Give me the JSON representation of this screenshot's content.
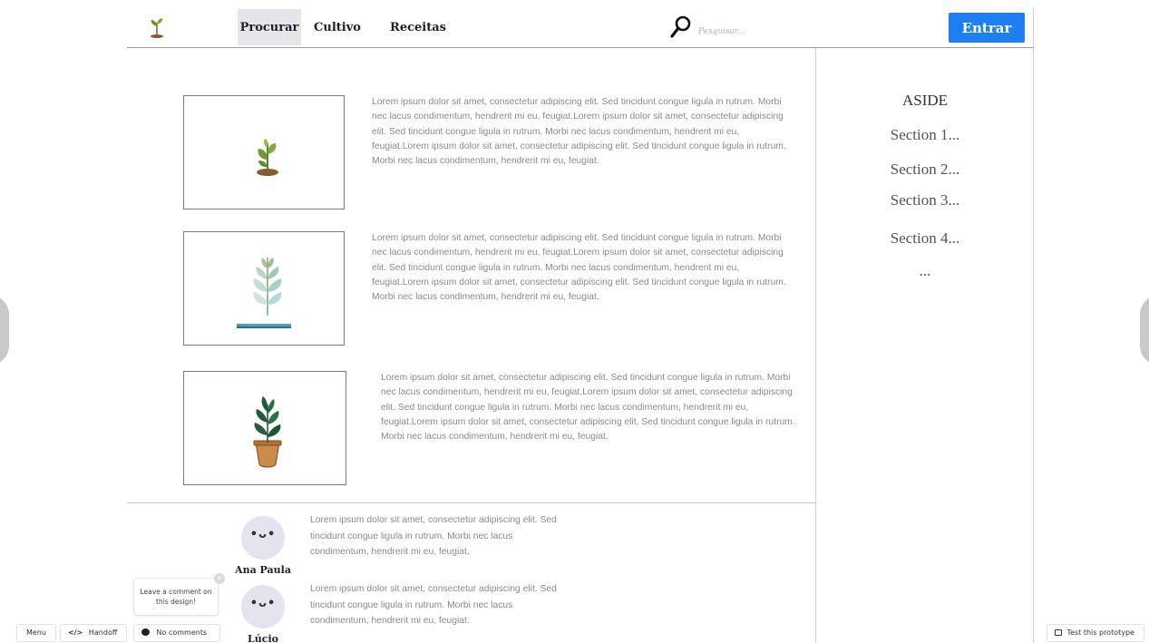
{
  "header": {
    "logo_icon": "sprout-icon",
    "nav": [
      {
        "label": "Procurar",
        "active": true
      },
      {
        "label": "Cultivo",
        "active": false
      },
      {
        "label": "Receitas",
        "active": false
      }
    ],
    "search": {
      "icon": "search-icon",
      "placeholder": "Pesquisar..."
    },
    "login_label": "Entrar"
  },
  "articles": [
    {
      "image_icon": "sprout-in-soil-icon",
      "text": "Lorem ipsum dolor sit amet, consectetur adipiscing elit. Sed tincidunt congue ligula in rutrum. Morbi nec lacus condimentum, hendrerit mi eu, feugiat.Lorem ipsum dolor sit amet, consectetur adipiscing elit. Sed tincidunt congue ligula in rutrum. Morbi nec lacus condimentum, hendrerit mi eu, feugiat.Lorem ipsum dolor sit amet, consectetur adipiscing elit. Sed tincidunt congue ligula in rutrum. Morbi nec lacus condimentum, hendrerit mi eu, feugiat."
    },
    {
      "image_icon": "leafy-branch-icon",
      "text": "Lorem ipsum dolor sit amet, consectetur adipiscing elit. Sed tincidunt congue ligula in rutrum. Morbi nec lacus condimentum, hendrerit mi eu, feugiat.Lorem ipsum dolor sit amet, consectetur adipiscing elit. Sed tincidunt congue ligula in rutrum. Morbi nec lacus condimentum, hendrerit mi eu, feugiat.Lorem ipsum dolor sit amet, consectetur adipiscing elit. Sed tincidunt congue ligula in rutrum. Morbi nec lacus condimentum, hendrerit mi eu, feugiat."
    },
    {
      "image_icon": "potted-plant-icon",
      "text": "Lorem ipsum dolor sit amet, consectetur adipiscing elit. Sed tincidunt congue ligula in rutrum. Morbi nec lacus condimentum, hendrerit mi eu, feugiat.Lorem ipsum dolor sit amet, consectetur adipiscing elit. Sed tincidunt congue ligula in rutrum. Morbi nec lacus condimentum, hendrerit mi eu, feugiat.Lorem ipsum dolor sit amet, consectetur adipiscing elit. Sed tincidunt congue ligula in rutrum. Morbi nec lacus condimentum, hendrerit mi eu, feugiat."
    }
  ],
  "aside": {
    "title": "ASIDE",
    "items": [
      "Section 1...",
      "Section 2...",
      "Section 3...",
      "Section 4...",
      "..."
    ]
  },
  "comments": [
    {
      "name": "Ana Paula",
      "avatar_face": "•ᴗ•",
      "text": "Lorem ipsum dolor sit amet, consectetur adipiscing elit. Sed tincidunt congue ligula in rutrum. Morbi nec lacus condimentum, hendrerit mi eu, feugiat."
    },
    {
      "name": "Lúcio",
      "avatar_face": "•ᴗ•",
      "text": "Lorem ipsum dolor sit amet, consectetur adipiscing elit. Sed tincidunt congue ligula in rutrum. Morbi nec lacus condimentum, hendrerit mi eu, feugiat."
    }
  ],
  "toolbar": {
    "menu_label": "Menu",
    "handoff_label": "Handoff",
    "comments_label": "No comments",
    "test_label": "Test this prototype",
    "tooltip_text": "Leave a comment on this design!",
    "tooltip_close": "×"
  },
  "colors": {
    "accent": "#1e7ff0",
    "active_nav_bg": "#e6e6ea"
  }
}
